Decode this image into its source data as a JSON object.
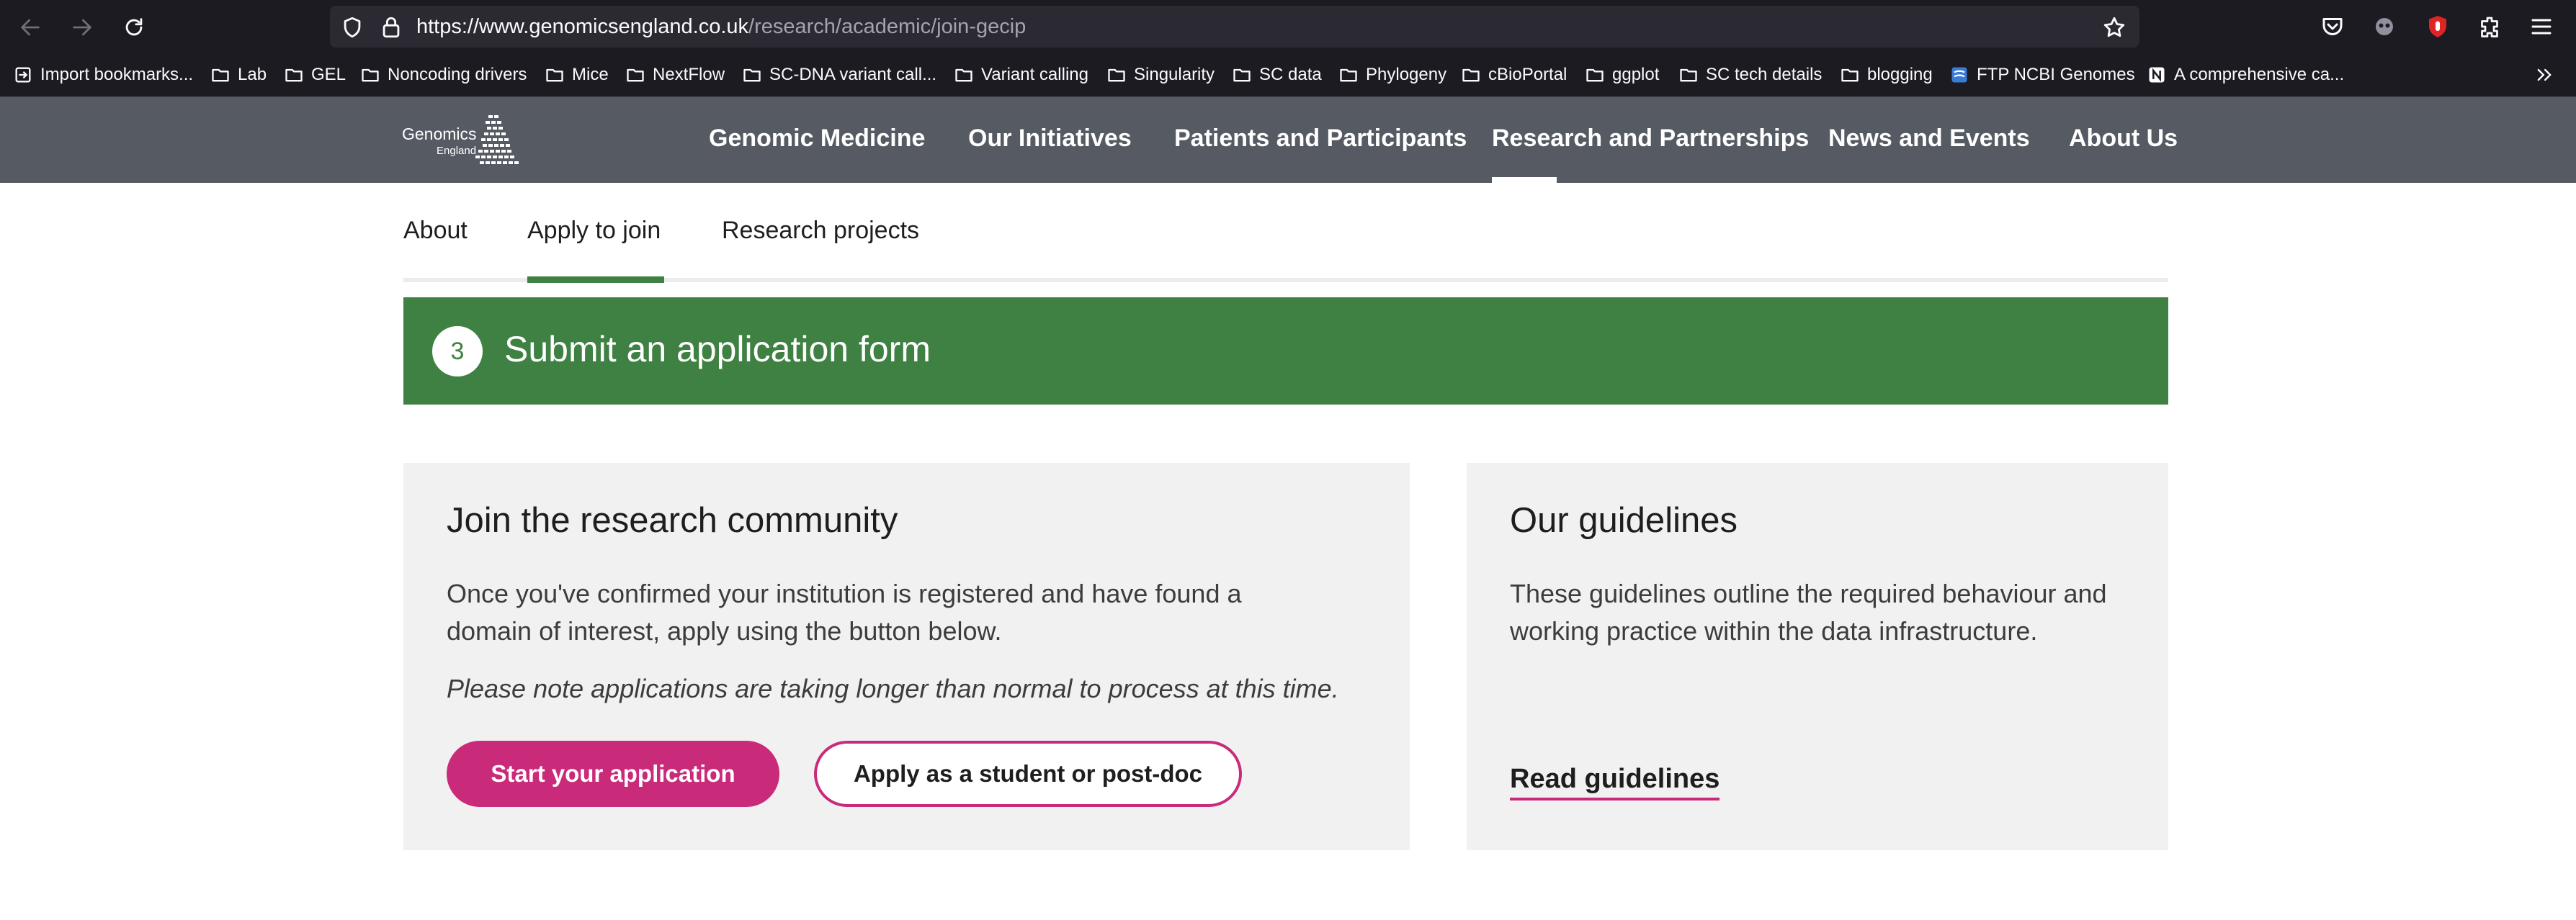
{
  "browser": {
    "url_host": "https://www.genomicsengland.co.uk",
    "url_path": "/research/academic/join-gecip",
    "icons": [
      "back-icon",
      "forward-icon",
      "reload-icon",
      "shield-icon",
      "lock-icon",
      "star-icon",
      "pocket-icon",
      "extension-icon",
      "ublock-icon",
      "puzzle-icon",
      "menu-icon"
    ]
  },
  "bookmarks": [
    {
      "label": "Import bookmarks...",
      "icon": "import-icon"
    },
    {
      "label": "Lab",
      "icon": "folder-icon"
    },
    {
      "label": "GEL",
      "icon": "folder-icon"
    },
    {
      "label": "Noncoding drivers",
      "icon": "folder-icon"
    },
    {
      "label": "Mice",
      "icon": "folder-icon"
    },
    {
      "label": "NextFlow",
      "icon": "folder-icon"
    },
    {
      "label": "SC-DNA variant call...",
      "icon": "folder-icon"
    },
    {
      "label": "Variant calling",
      "icon": "folder-icon"
    },
    {
      "label": "Singularity",
      "icon": "folder-icon"
    },
    {
      "label": "SC data",
      "icon": "folder-icon"
    },
    {
      "label": "Phylogeny",
      "icon": "folder-icon"
    },
    {
      "label": "cBioPortal",
      "icon": "folder-icon"
    },
    {
      "label": "ggplot",
      "icon": "folder-icon"
    },
    {
      "label": "SC tech details",
      "icon": "folder-icon"
    },
    {
      "label": "blogging",
      "icon": "folder-icon"
    },
    {
      "label": "FTP NCBI Genomes",
      "icon": "ncbi-icon"
    },
    {
      "label": "A comprehensive ca...",
      "icon": "notion-icon"
    }
  ],
  "site": {
    "logo_line1": "Genomics",
    "logo_line2": "England",
    "main_nav": [
      "Genomic Medicine",
      "Our Initiatives",
      "Patients and Participants",
      "Research and Partnerships",
      "News and Events",
      "About Us"
    ],
    "sub_nav": [
      "About",
      "Apply to join",
      "Research projects"
    ]
  },
  "step": {
    "number": "3",
    "title": "Submit an application form"
  },
  "join_card": {
    "title": "Join the research community",
    "body": "Once you've confirmed your institution is registered and have found a domain of interest, apply using the button below.",
    "note": "Please note applications are taking longer than normal to process at this time.",
    "primary_button": "Start your application",
    "secondary_button": "Apply as a student or post-doc"
  },
  "guidelines_card": {
    "title": "Our guidelines",
    "body": "These guidelines outline the required behaviour and working practice within the data infrastructure.",
    "link": "Read guidelines"
  },
  "colors": {
    "chrome_bg": "#1c1b22",
    "header_bg": "#565a63",
    "green": "#3e8142",
    "pink": "#c92b7a",
    "card_bg": "#f1f1f1"
  }
}
